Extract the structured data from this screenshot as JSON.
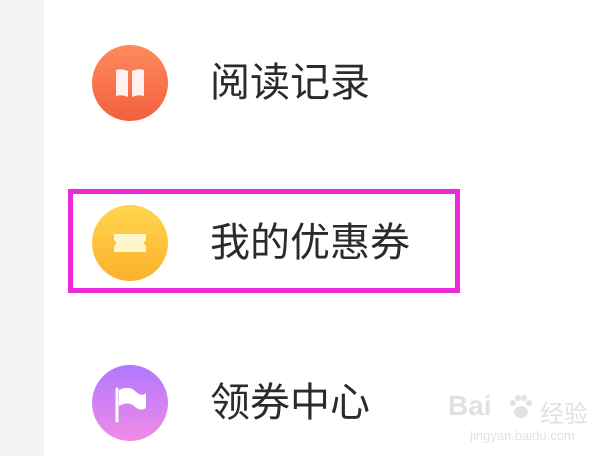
{
  "menu": {
    "items": [
      {
        "label": "阅读记录",
        "icon": "book-icon",
        "color": "#f2603e"
      },
      {
        "label": "我的优惠券",
        "icon": "coupon-ticket-icon",
        "color": "#fbb12b"
      },
      {
        "label": "领券中心",
        "icon": "flag-icon",
        "color": "#b177ff"
      }
    ]
  },
  "annotation": {
    "highlight_color": "#e92ad8",
    "highlighted_item": "我的优惠券"
  },
  "watermark": {
    "brand": "Bai",
    "brand_suffix": "经验",
    "url": "jingyan.baidu.com"
  }
}
